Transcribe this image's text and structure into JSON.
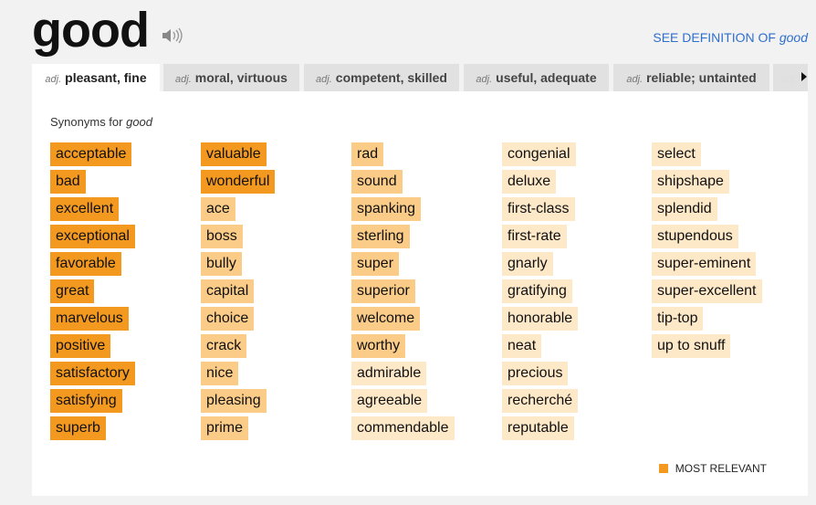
{
  "header": {
    "word": "good",
    "see_definition_prefix": "SEE DEFINITION OF ",
    "see_definition_word": "good"
  },
  "tabs": [
    {
      "pos": "adj.",
      "label": "pleasant, fine",
      "active": true
    },
    {
      "pos": "adj.",
      "label": "moral, virtuous"
    },
    {
      "pos": "adj.",
      "label": "competent, skilled"
    },
    {
      "pos": "adj.",
      "label": "useful, adequate"
    },
    {
      "pos": "adj.",
      "label": "reliable; untainted"
    },
    {
      "pos": "adj.",
      "label": ""
    }
  ],
  "panel": {
    "synonyms_prefix": "Synonyms for ",
    "synonyms_word": "good"
  },
  "colors": {
    "most_relevant": "#f4991f",
    "relevant": "#fbcb88",
    "less_relevant": "#fde8c8",
    "link": "#2f6fcc"
  },
  "columns": [
    [
      [
        "acceptable",
        3
      ],
      [
        "bad",
        3
      ],
      [
        "excellent",
        3
      ],
      [
        "exceptional",
        3
      ],
      [
        "favorable",
        3
      ],
      [
        "great",
        3
      ],
      [
        "marvelous",
        3
      ],
      [
        "positive",
        3
      ],
      [
        "satisfactory",
        3
      ],
      [
        "satisfying",
        3
      ],
      [
        "superb",
        3
      ]
    ],
    [
      [
        "valuable",
        3
      ],
      [
        "wonderful",
        3
      ],
      [
        "ace",
        2
      ],
      [
        "boss",
        2
      ],
      [
        "bully",
        2
      ],
      [
        "capital",
        2
      ],
      [
        "choice",
        2
      ],
      [
        "crack",
        2
      ],
      [
        "nice",
        2
      ],
      [
        "pleasing",
        2
      ],
      [
        "prime",
        2
      ]
    ],
    [
      [
        "rad",
        2
      ],
      [
        "sound",
        2
      ],
      [
        "spanking",
        2
      ],
      [
        "sterling",
        2
      ],
      [
        "super",
        2
      ],
      [
        "superior",
        2
      ],
      [
        "welcome",
        2
      ],
      [
        "worthy",
        2
      ],
      [
        "admirable",
        1
      ],
      [
        "agreeable",
        1
      ],
      [
        "commendable",
        1
      ]
    ],
    [
      [
        "congenial",
        1
      ],
      [
        "deluxe",
        1
      ],
      [
        "first-class",
        1
      ],
      [
        "first-rate",
        1
      ],
      [
        "gnarly",
        1
      ],
      [
        "gratifying",
        1
      ],
      [
        "honorable",
        1
      ],
      [
        "neat",
        1
      ],
      [
        "precious",
        1
      ],
      [
        "recherché",
        1
      ],
      [
        "reputable",
        1
      ]
    ],
    [
      [
        "select",
        1
      ],
      [
        "shipshape",
        1
      ],
      [
        "splendid",
        1
      ],
      [
        "stupendous",
        1
      ],
      [
        "super-eminent",
        1
      ],
      [
        "super-excellent",
        1
      ],
      [
        "tip-top",
        1
      ],
      [
        "up to snuff",
        1
      ]
    ]
  ],
  "legend": {
    "label": "MOST RELEVANT"
  }
}
